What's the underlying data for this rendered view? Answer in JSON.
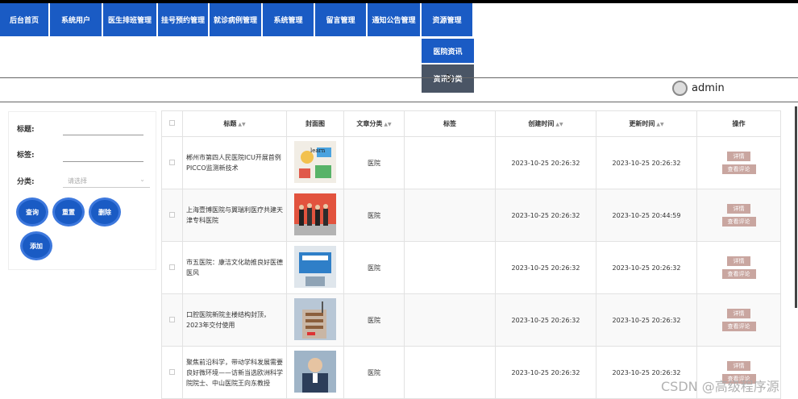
{
  "nav": [
    "后台首页",
    "系统用户",
    "医生排班管理",
    "挂号预约管理",
    "就诊病例管理",
    "系统管理",
    "留言管理",
    "通知公告管理",
    "资源管理"
  ],
  "submenu": [
    "医院资讯",
    "资讯分类"
  ],
  "user": {
    "name": "admin"
  },
  "filters": {
    "title_label": "标题:",
    "tag_label": "标签:",
    "category_label": "分类:",
    "category_placeholder": "请选择"
  },
  "buttons": {
    "search": "查询",
    "reset": "重置",
    "delete": "删除",
    "add": "添加"
  },
  "table": {
    "headers": [
      "标题",
      "封面图",
      "文章分类",
      "标签",
      "创建时间",
      "更新时间",
      "操作"
    ],
    "ops": [
      "详情",
      "查看评论"
    ],
    "rows": [
      {
        "title": "郴州市第四人民医院ICU开展首例PICCO监测新技术",
        "category": "医院",
        "tag": "",
        "created": "2023-10-25 20:26:32",
        "updated": "2023-10-25 20:26:32"
      },
      {
        "title": "上海壹博医院与翼瑞利医疗共建天津专科医院",
        "category": "医院",
        "tag": "",
        "created": "2023-10-25 20:26:32",
        "updated": "2023-10-25 20:44:59"
      },
      {
        "title": "市五医院：康洁文化助推良好医德医风",
        "category": "医院",
        "tag": "",
        "created": "2023-10-25 20:26:32",
        "updated": "2023-10-25 20:26:32"
      },
      {
        "title": "口腔医院新院主楼结构封顶，2023年交付使用",
        "category": "医院",
        "tag": "",
        "created": "2023-10-25 20:26:32",
        "updated": "2023-10-25 20:26:32"
      },
      {
        "title": "聚焦前沿科学，带动学科发展需要良好微环境——访新当选欧洲科学院院士、中山医院王向东教授",
        "category": "医院",
        "tag": "",
        "created": "2023-10-25 20:26:32",
        "updated": "2023-10-25 20:26:32"
      }
    ]
  },
  "watermark": "CSDN @高级程序源",
  "colors": {
    "nav": "#1a5bc4",
    "submenu_hover": "#4a5565",
    "op_button": "#c9a6a0"
  }
}
